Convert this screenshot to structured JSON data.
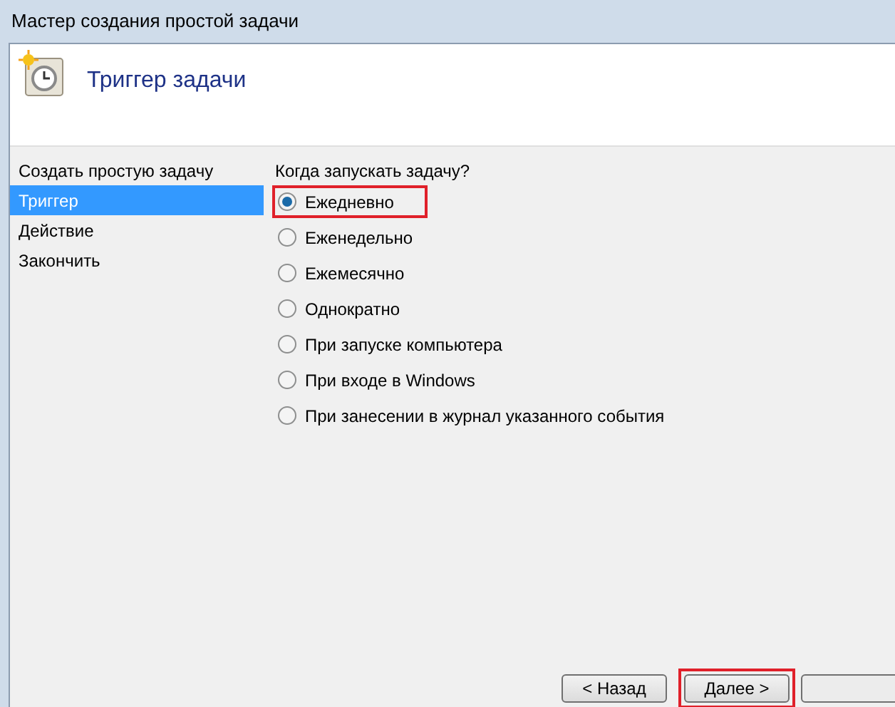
{
  "window": {
    "title": "Мастер создания простой задачи"
  },
  "header": {
    "title": "Триггер задачи"
  },
  "sidebar": {
    "items": [
      {
        "label": "Создать простую задачу",
        "selected": false
      },
      {
        "label": "Триггер",
        "selected": true
      },
      {
        "label": "Действие",
        "selected": false
      },
      {
        "label": "Закончить",
        "selected": false
      }
    ]
  },
  "question": "Когда запускать задачу?",
  "options": [
    {
      "label": "Ежедневно",
      "selected": true,
      "highlighted": true
    },
    {
      "label": "Еженедельно",
      "selected": false,
      "highlighted": false
    },
    {
      "label": "Ежемесячно",
      "selected": false,
      "highlighted": false
    },
    {
      "label": "Однократно",
      "selected": false,
      "highlighted": false
    },
    {
      "label": "При запуске компьютера",
      "selected": false,
      "highlighted": false
    },
    {
      "label": "При входе в Windows",
      "selected": false,
      "highlighted": false
    },
    {
      "label": "При занесении в журнал указанного события",
      "selected": false,
      "highlighted": false
    }
  ],
  "buttons": [
    {
      "label": "< Назад",
      "highlighted": false
    },
    {
      "label": "Далее >",
      "highlighted": true
    }
  ]
}
